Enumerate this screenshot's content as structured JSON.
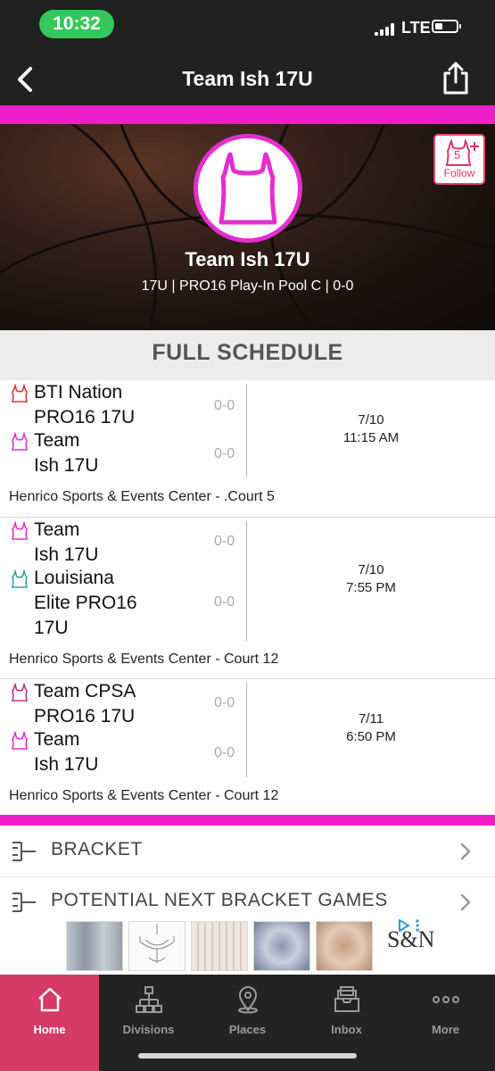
{
  "status_bar": {
    "time": "10:32",
    "network": "LTE"
  },
  "nav": {
    "title": "Team Ish 17U",
    "back_icon": "chevron-left-icon",
    "share_icon": "share-icon"
  },
  "hero": {
    "team_name": "Team Ish 17U",
    "subtitle": "17U | PRO16 Play-In Pool C | 0-0",
    "follow_label": "Follow",
    "follow_badge": "5"
  },
  "schedule": {
    "header": "FULL SCHEDULE",
    "games": [
      {
        "home_team": {
          "line1": "BTI Nation",
          "line2": "PRO16 17U",
          "line3": "",
          "score": "0-0",
          "color": "#e0343c"
        },
        "away_team": {
          "line1": "Team",
          "line2": "Ish 17U",
          "line3": "",
          "score": "0-0",
          "color": "#e62ed0"
        },
        "date": "7/10",
        "time": "11:15 AM",
        "venue": "Henrico Sports & Events Center - .Court 5"
      },
      {
        "home_team": {
          "line1": "Team",
          "line2": "Ish 17U",
          "line3": "",
          "score": "0-0",
          "color": "#e62ed0"
        },
        "away_team": {
          "line1": "Louisiana",
          "line2": "Elite PRO16",
          "line3": "17U",
          "score": "0-0",
          "color": "#3aa39a"
        },
        "date": "7/10",
        "time": "7:55 PM",
        "venue": "Henrico Sports & Events Center - Court 12"
      },
      {
        "home_team": {
          "line1": "Team CPSA",
          "line2": "PRO16 17U",
          "line3": "",
          "score": "0-0",
          "color": "#c0308a"
        },
        "away_team": {
          "line1": "Team",
          "line2": "Ish 17U",
          "line3": "",
          "score": "0-0",
          "color": "#e62ed0"
        },
        "date": "7/11",
        "time": "6:50 PM",
        "venue": "Henrico Sports & Events Center - Court 12"
      }
    ]
  },
  "links": [
    {
      "label": "BRACKET",
      "icon": "bracket-icon"
    },
    {
      "label": "POTENTIAL NEXT BRACKET GAMES",
      "icon": "bracket-icon"
    }
  ],
  "ad": {
    "brand": "S&N",
    "items": [
      "rug-1",
      "chandelier",
      "rug-2",
      "rug-3",
      "rug-4"
    ]
  },
  "tabs": [
    {
      "label": "Home",
      "icon": "home-icon",
      "active": true
    },
    {
      "label": "Divisions",
      "icon": "divisions-icon",
      "active": false
    },
    {
      "label": "Places",
      "icon": "location-pin-icon",
      "active": false
    },
    {
      "label": "Inbox",
      "icon": "inbox-icon",
      "active": false
    },
    {
      "label": "More",
      "icon": "more-icon",
      "active": false
    }
  ],
  "colors": {
    "accent_pink": "#ee1fc8",
    "tab_active": "#d63a67",
    "bar_dark": "#212121"
  }
}
